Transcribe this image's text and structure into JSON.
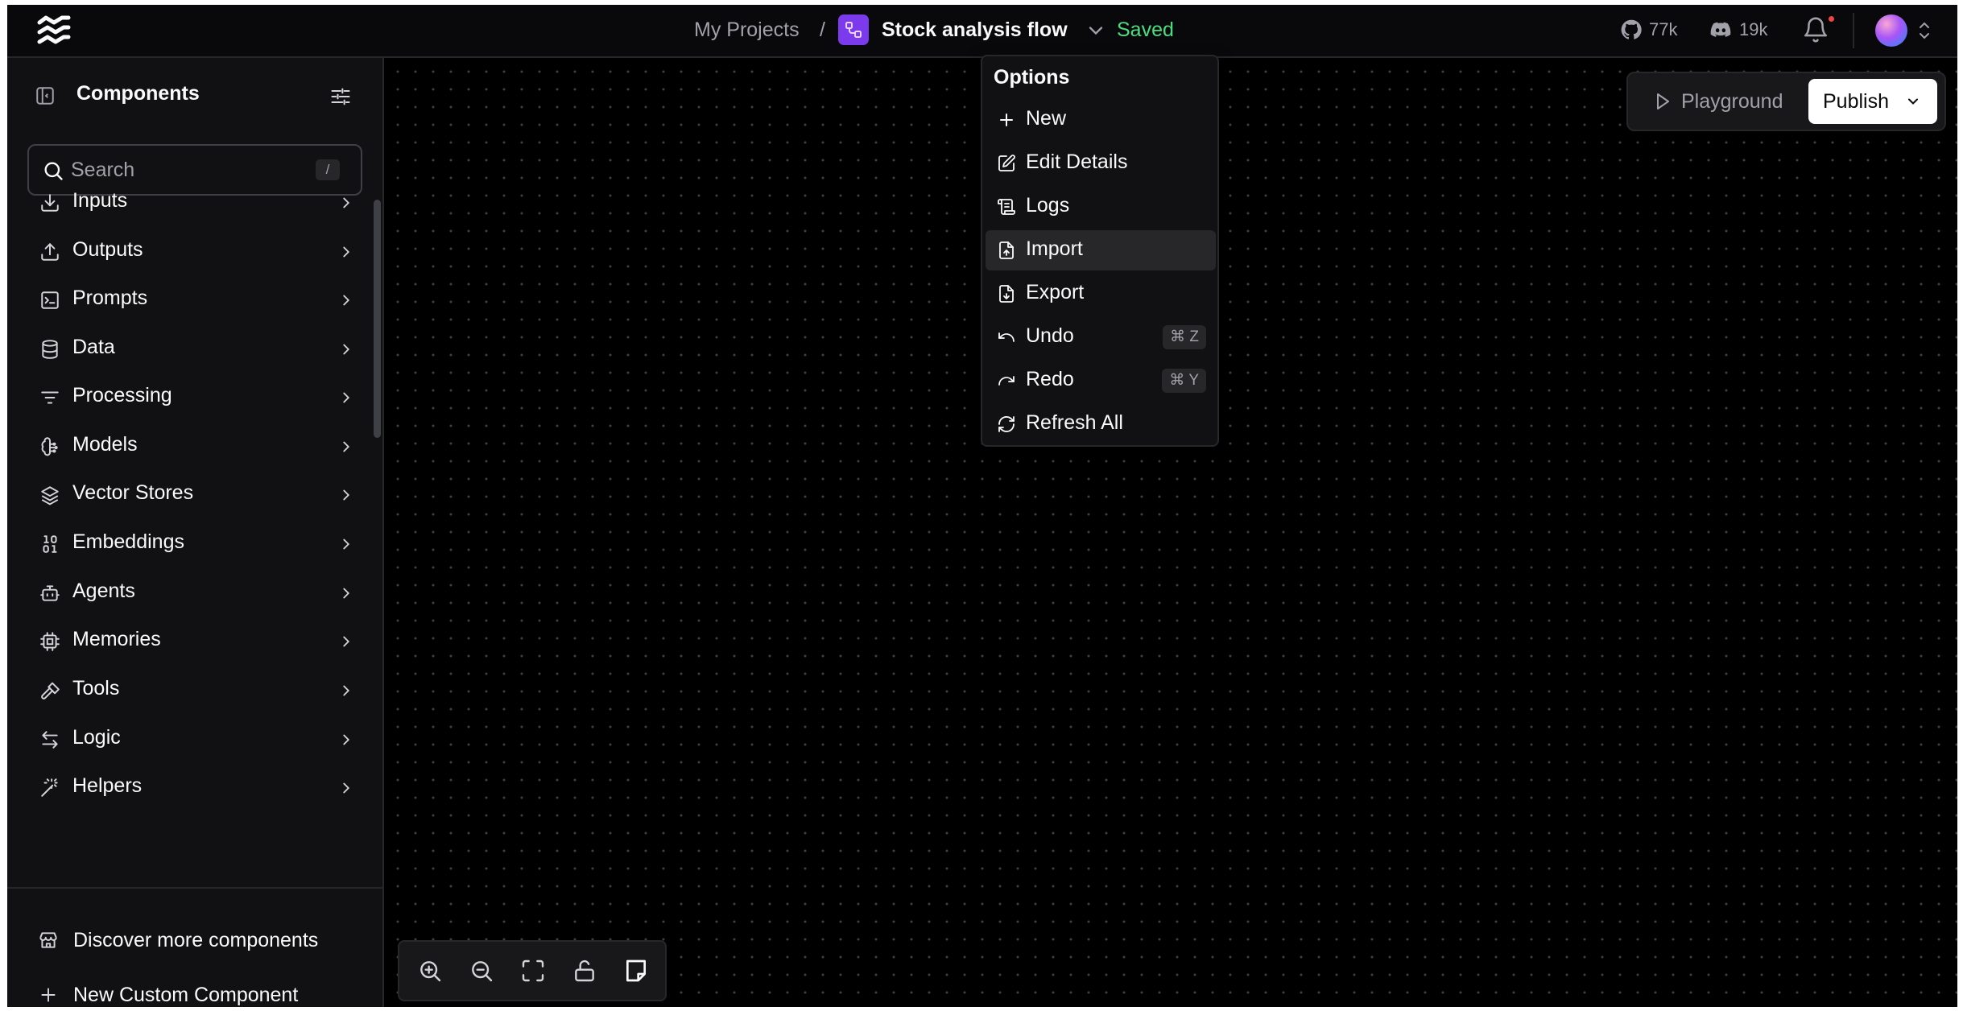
{
  "header": {
    "breadcrumb_projects": "My Projects",
    "breadcrumb_separator": "/",
    "flow_name": "Stock analysis flow",
    "save_status": "Saved",
    "github_stars": "77k",
    "discord_members": "19k",
    "notification_dot_color": "#ef4444",
    "brand_color": "#7c3aed",
    "saved_color": "#4ade80"
  },
  "sidebar": {
    "title": "Components",
    "search_placeholder": "Search",
    "search_shortcut": "/",
    "categories": [
      {
        "label": "Inputs",
        "icon": "download-icon"
      },
      {
        "label": "Outputs",
        "icon": "upload-icon"
      },
      {
        "label": "Prompts",
        "icon": "terminal-square-icon"
      },
      {
        "label": "Data",
        "icon": "database-icon"
      },
      {
        "label": "Processing",
        "icon": "list-filter-icon"
      },
      {
        "label": "Models",
        "icon": "brain-circuit-icon"
      },
      {
        "label": "Vector Stores",
        "icon": "layers-icon"
      },
      {
        "label": "Embeddings",
        "icon": "binary-icon"
      },
      {
        "label": "Agents",
        "icon": "bot-icon"
      },
      {
        "label": "Memories",
        "icon": "cpu-icon"
      },
      {
        "label": "Tools",
        "icon": "hammer-icon"
      },
      {
        "label": "Logic",
        "icon": "arrow-left-right-icon"
      },
      {
        "label": "Helpers",
        "icon": "wand-icon"
      }
    ],
    "footer": {
      "discover_label": "Discover more components",
      "new_custom_label": "New Custom Component"
    }
  },
  "canvas": {
    "playground_label": "Playground",
    "publish_label": "Publish",
    "zoom_controls": [
      "zoom-in-icon",
      "zoom-out-icon",
      "fit-view-icon",
      "unlock-icon",
      "note-icon"
    ]
  },
  "options_menu": {
    "title": "Options",
    "items": [
      {
        "label": "New",
        "icon": "plus-icon",
        "shortcut": ""
      },
      {
        "label": "Edit Details",
        "icon": "edit-icon",
        "shortcut": ""
      },
      {
        "label": "Logs",
        "icon": "scroll-text-icon",
        "shortcut": ""
      },
      {
        "label": "Import",
        "icon": "file-up-icon",
        "shortcut": "",
        "active": true
      },
      {
        "label": "Export",
        "icon": "file-down-icon",
        "shortcut": ""
      },
      {
        "label": "Undo",
        "icon": "undo-icon",
        "shortcut": "⌘ Z"
      },
      {
        "label": "Redo",
        "icon": "redo-icon",
        "shortcut": "⌘ Y"
      },
      {
        "label": "Refresh All",
        "icon": "refresh-icon",
        "shortcut": ""
      }
    ]
  }
}
